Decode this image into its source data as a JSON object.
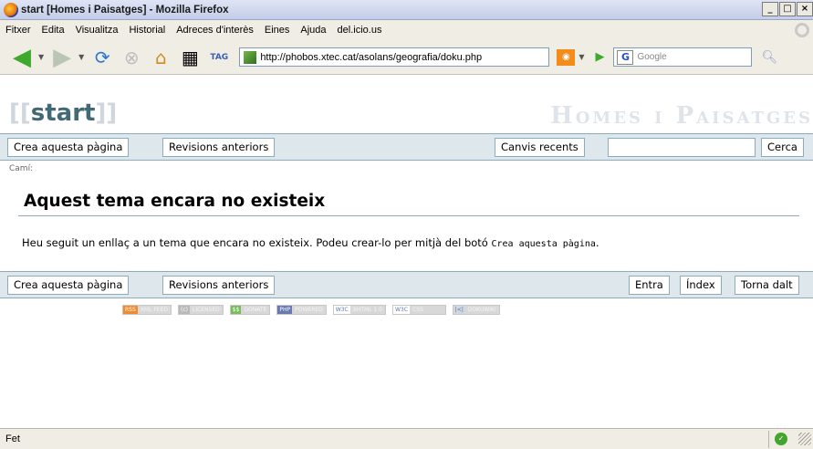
{
  "window": {
    "title": "start [Homes i Paisatges] - Mozilla Firefox",
    "min": "_",
    "max": "□",
    "close": "×"
  },
  "menu": [
    "Fitxer",
    "Edita",
    "Visualitza",
    "Historial",
    "Adreces d'interès",
    "Eines",
    "Ajuda",
    "del.icio.us"
  ],
  "nav": {
    "url": "http://phobos.xtec.cat/asolans/geografia/doku.php",
    "search_placeholder": "Google",
    "tag_label": "TAG"
  },
  "page": {
    "logo_brackets_open": "[[",
    "logo_word": "start",
    "logo_brackets_close": "]]",
    "site_name": "Homes i Paisatges",
    "top_buttons": {
      "create": "Crea aquesta pàgina",
      "revisions": "Revisions anteriors",
      "recent": "Canvis recents",
      "search": "Cerca"
    },
    "breadcrumb": "Camí:",
    "heading": "Aquest tema encara no existeix",
    "paragraph_pre": "Heu seguit un enllaç a un tema que encara no existeix. Podeu crear-lo per mitjà del botó",
    "paragraph_code": "Crea aquesta pàgina",
    "paragraph_post": ".",
    "bottom_buttons": {
      "create": "Crea aquesta pàgina",
      "revisions": "Revisions anteriors",
      "login": "Entra",
      "index": "Índex",
      "top": "Torna dalt"
    },
    "badges": [
      {
        "left": "RSS",
        "right": "XML FEED",
        "color": "#f08a2c"
      },
      {
        "left": "(c)",
        "right": "LICENSED",
        "color": "#b9b9b9"
      },
      {
        "left": "$$",
        "right": "DONATE",
        "color": "#7bbd5a"
      },
      {
        "left": "PHP",
        "right": "POWERED",
        "color": "#6a78b2"
      },
      {
        "left": "W3C",
        "right": "XHTML 1.0",
        "color": "#ffffff"
      },
      {
        "left": "W3C",
        "right": "CSS",
        "color": "#ffffff"
      },
      {
        "left": "|<|",
        "right": "DOKUWIKI",
        "color": "#cfd8e3"
      }
    ]
  },
  "status": {
    "text": "Fet"
  }
}
